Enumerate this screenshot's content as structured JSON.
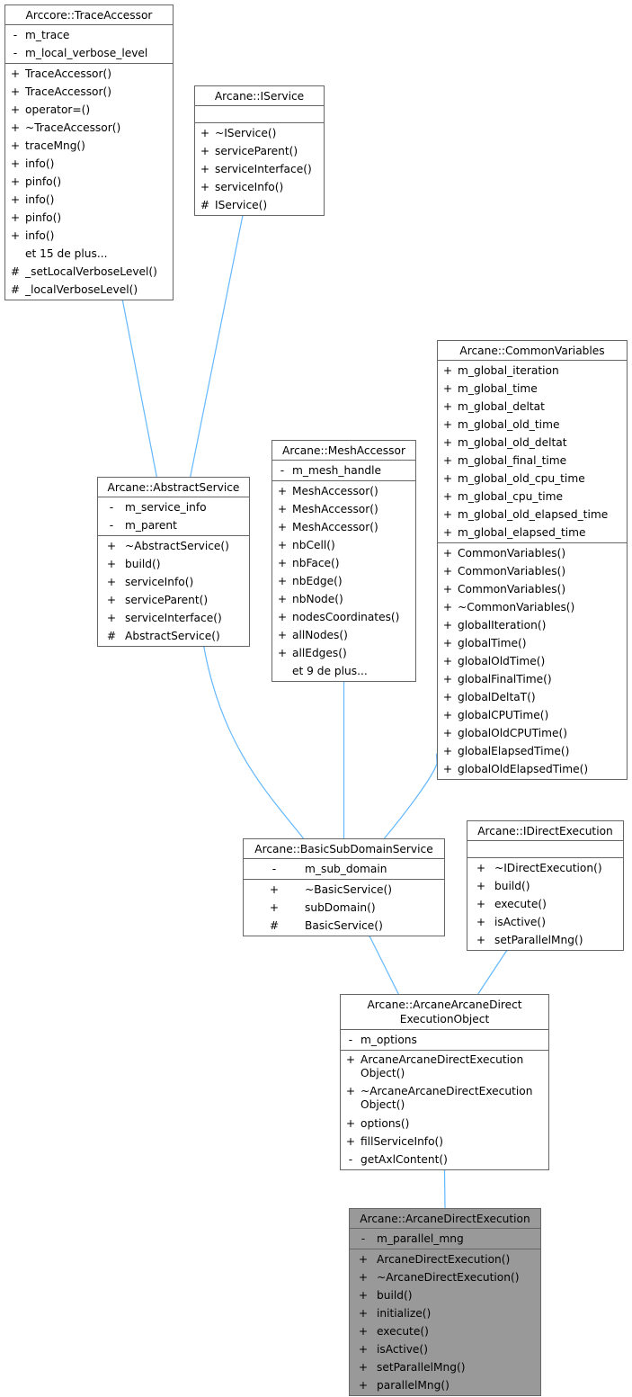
{
  "diagram": {
    "type": "class-inheritance",
    "edge_color": "#63b8ff",
    "classes": {
      "trace_accessor": {
        "name": "Arccore::TraceAccessor",
        "attributes": [
          {
            "vis": "-",
            "name": "m_trace"
          },
          {
            "vis": "-",
            "name": "m_local_verbose_level"
          }
        ],
        "methods": [
          {
            "vis": "+",
            "name": "TraceAccessor()"
          },
          {
            "vis": "+",
            "name": "TraceAccessor()"
          },
          {
            "vis": "+",
            "name": "operator=()"
          },
          {
            "vis": "+",
            "name": "~TraceAccessor()"
          },
          {
            "vis": "+",
            "name": "traceMng()"
          },
          {
            "vis": "+",
            "name": "info()"
          },
          {
            "vis": "+",
            "name": "pinfo()"
          },
          {
            "vis": "+",
            "name": "info()"
          },
          {
            "vis": "+",
            "name": "pinfo()"
          },
          {
            "vis": "+",
            "name": "info()"
          },
          {
            "vis": "",
            "name": "et 15 de plus..."
          },
          {
            "vis": "#",
            "name": "_setLocalVerboseLevel()"
          },
          {
            "vis": "#",
            "name": "_localVerboseLevel()"
          }
        ]
      },
      "iservice": {
        "name": "Arcane::IService",
        "attributes": [],
        "methods": [
          {
            "vis": "+",
            "name": "~IService()"
          },
          {
            "vis": "+",
            "name": "serviceParent()"
          },
          {
            "vis": "+",
            "name": "serviceInterface()"
          },
          {
            "vis": "+",
            "name": "serviceInfo()"
          },
          {
            "vis": "#",
            "name": "IService()"
          }
        ]
      },
      "common_variables": {
        "name": "Arcane::CommonVariables",
        "attributes": [
          {
            "vis": "+",
            "name": "m_global_iteration"
          },
          {
            "vis": "+",
            "name": "m_global_time"
          },
          {
            "vis": "+",
            "name": "m_global_deltat"
          },
          {
            "vis": "+",
            "name": "m_global_old_time"
          },
          {
            "vis": "+",
            "name": "m_global_old_deltat"
          },
          {
            "vis": "+",
            "name": "m_global_final_time"
          },
          {
            "vis": "+",
            "name": "m_global_old_cpu_time"
          },
          {
            "vis": "+",
            "name": "m_global_cpu_time"
          },
          {
            "vis": "+",
            "name": "m_global_old_elapsed_time"
          },
          {
            "vis": "+",
            "name": "m_global_elapsed_time"
          }
        ],
        "methods": [
          {
            "vis": "+",
            "name": "CommonVariables()"
          },
          {
            "vis": "+",
            "name": "CommonVariables()"
          },
          {
            "vis": "+",
            "name": "CommonVariables()"
          },
          {
            "vis": "+",
            "name": "~CommonVariables()"
          },
          {
            "vis": "+",
            "name": "globalIteration()"
          },
          {
            "vis": "+",
            "name": "globalTime()"
          },
          {
            "vis": "+",
            "name": "globalOldTime()"
          },
          {
            "vis": "+",
            "name": "globalFinalTime()"
          },
          {
            "vis": "+",
            "name": "globalDeltaT()"
          },
          {
            "vis": "+",
            "name": "globalCPUTime()"
          },
          {
            "vis": "+",
            "name": "globalOldCPUTime()"
          },
          {
            "vis": "+",
            "name": "globalElapsedTime()"
          },
          {
            "vis": "+",
            "name": "globalOldElapsedTime()"
          }
        ]
      },
      "abstract_service": {
        "name": "Arcane::AbstractService",
        "attributes": [
          {
            "vis": "-",
            "name": "m_service_info"
          },
          {
            "vis": "-",
            "name": "m_parent"
          }
        ],
        "methods": [
          {
            "vis": "+",
            "name": "~AbstractService()"
          },
          {
            "vis": "+",
            "name": "build()"
          },
          {
            "vis": "+",
            "name": "serviceInfo()"
          },
          {
            "vis": "+",
            "name": "serviceParent()"
          },
          {
            "vis": "+",
            "name": "serviceInterface()"
          },
          {
            "vis": "#",
            "name": "AbstractService()"
          }
        ]
      },
      "mesh_accessor": {
        "name": "Arcane::MeshAccessor",
        "attributes": [
          {
            "vis": "-",
            "name": "m_mesh_handle"
          }
        ],
        "methods": [
          {
            "vis": "+",
            "name": "MeshAccessor()"
          },
          {
            "vis": "+",
            "name": "MeshAccessor()"
          },
          {
            "vis": "+",
            "name": "MeshAccessor()"
          },
          {
            "vis": "+",
            "name": "nbCell()"
          },
          {
            "vis": "+",
            "name": "nbFace()"
          },
          {
            "vis": "+",
            "name": "nbEdge()"
          },
          {
            "vis": "+",
            "name": "nbNode()"
          },
          {
            "vis": "+",
            "name": "nodesCoordinates()"
          },
          {
            "vis": "+",
            "name": "allNodes()"
          },
          {
            "vis": "+",
            "name": "allEdges()"
          },
          {
            "vis": "",
            "name": "et 9 de plus..."
          }
        ]
      },
      "basic_sub_domain_service": {
        "name": "Arcane::BasicSubDomainService",
        "attributes": [
          {
            "vis": "-",
            "name": "m_sub_domain"
          }
        ],
        "methods": [
          {
            "vis": "+",
            "name": "~BasicService()"
          },
          {
            "vis": "+",
            "name": "subDomain()"
          },
          {
            "vis": "#",
            "name": "BasicService()"
          }
        ]
      },
      "idirect_execution": {
        "name": "Arcane::IDirectExecution",
        "attributes": [],
        "methods": [
          {
            "vis": "+",
            "name": "~IDirectExecution()"
          },
          {
            "vis": "+",
            "name": "build()"
          },
          {
            "vis": "+",
            "name": "execute()"
          },
          {
            "vis": "+",
            "name": "isActive()"
          },
          {
            "vis": "+",
            "name": "setParallelMng()"
          }
        ]
      },
      "arcane_arcane_direct_execution_object": {
        "name": "Arcane::ArcaneArcaneDirect ExecutionObject",
        "attributes": [
          {
            "vis": "-",
            "name": "m_options"
          }
        ],
        "methods": [
          {
            "vis": "+",
            "name": "ArcaneArcaneDirectExecution Object()"
          },
          {
            "vis": "+",
            "name": "~ArcaneArcaneDirectExecution Object()"
          },
          {
            "vis": "+",
            "name": "options()"
          },
          {
            "vis": "+",
            "name": "fillServiceInfo()"
          },
          {
            "vis": "-",
            "name": "getAxlContent()"
          }
        ]
      },
      "arcane_direct_execution": {
        "name": "Arcane::ArcaneDirectExecution",
        "highlighted": true,
        "attributes": [
          {
            "vis": "-",
            "name": "m_parallel_mng"
          }
        ],
        "methods": [
          {
            "vis": "+",
            "name": "ArcaneDirectExecution()"
          },
          {
            "vis": "+",
            "name": "~ArcaneDirectExecution()"
          },
          {
            "vis": "+",
            "name": "build()"
          },
          {
            "vis": "+",
            "name": "initialize()"
          },
          {
            "vis": "+",
            "name": "execute()"
          },
          {
            "vis": "+",
            "name": "isActive()"
          },
          {
            "vis": "+",
            "name": "setParallelMng()"
          },
          {
            "vis": "+",
            "name": "parallelMng()"
          }
        ]
      }
    },
    "inheritance": [
      {
        "child": "abstract_service",
        "parent": "trace_accessor"
      },
      {
        "child": "abstract_service",
        "parent": "iservice"
      },
      {
        "child": "basic_sub_domain_service",
        "parent": "abstract_service"
      },
      {
        "child": "basic_sub_domain_service",
        "parent": "mesh_accessor"
      },
      {
        "child": "basic_sub_domain_service",
        "parent": "common_variables"
      },
      {
        "child": "arcane_arcane_direct_execution_object",
        "parent": "basic_sub_domain_service"
      },
      {
        "child": "arcane_arcane_direct_execution_object",
        "parent": "idirect_execution"
      },
      {
        "child": "arcane_direct_execution",
        "parent": "arcane_arcane_direct_execution_object"
      }
    ]
  }
}
